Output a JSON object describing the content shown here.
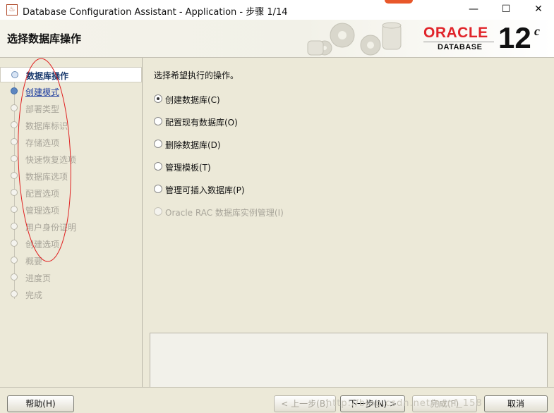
{
  "window": {
    "title": "Database Configuration Assistant - Application - 步骤 1/14",
    "icon": "java-cup-icon",
    "min_glyph": "—",
    "max_glyph": "☐",
    "close_glyph": "✕"
  },
  "header": {
    "heading": "选择数据库操作",
    "logo_text": "ORACLE",
    "logo_sub": "DATABASE",
    "version_number": "12",
    "version_suffix": "c"
  },
  "steps": [
    {
      "label": "数据库操作",
      "state": "current"
    },
    {
      "label": "创建模式",
      "state": "next"
    },
    {
      "label": "部署类型",
      "state": "pending"
    },
    {
      "label": "数据库标识",
      "state": "pending"
    },
    {
      "label": "存储选项",
      "state": "pending"
    },
    {
      "label": "快速恢复选项",
      "state": "pending"
    },
    {
      "label": "数据库选项",
      "state": "pending"
    },
    {
      "label": "配置选项",
      "state": "pending"
    },
    {
      "label": "管理选项",
      "state": "pending"
    },
    {
      "label": "用户身份证明",
      "state": "pending"
    },
    {
      "label": "创建选项",
      "state": "pending"
    },
    {
      "label": "概要",
      "state": "pending"
    },
    {
      "label": "进度页",
      "state": "pending"
    },
    {
      "label": "完成",
      "state": "pending"
    }
  ],
  "content": {
    "prompt": "选择希望执行的操作。",
    "options": [
      {
        "label": "创建数据库(C)",
        "checked": true,
        "enabled": true
      },
      {
        "label": "配置现有数据库(O)",
        "checked": false,
        "enabled": true
      },
      {
        "label": "删除数据库(D)",
        "checked": false,
        "enabled": true
      },
      {
        "label": "管理模板(T)",
        "checked": false,
        "enabled": true
      },
      {
        "label": "管理可插入数据库(P)",
        "checked": false,
        "enabled": true
      },
      {
        "label": "Oracle RAC 数据库实例管理(I)",
        "checked": false,
        "enabled": false
      }
    ]
  },
  "buttons": {
    "help": "帮助(H)",
    "back": "< 上一步(B)",
    "next": "下一步(N) >",
    "finish": "完成(F)",
    "cancel": "取消"
  },
  "watermark": "http://blog.csdn.net/nanf_158",
  "colors": {
    "oracle_red": "#e0242a",
    "annotation_red": "#e02020",
    "current_step": "#1a3a6e",
    "next_step": "#1a3a9e"
  }
}
